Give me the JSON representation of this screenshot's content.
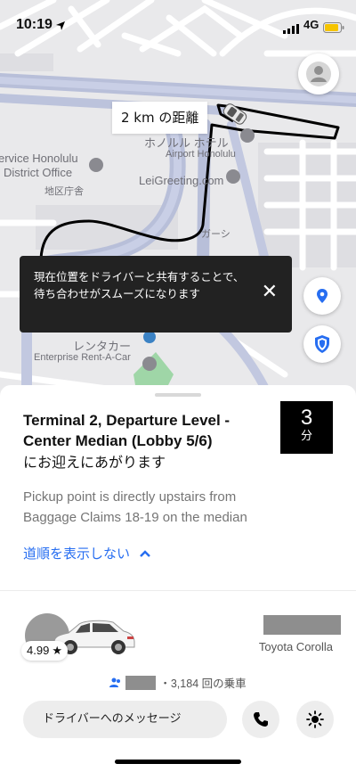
{
  "status_bar": {
    "time": "10:19",
    "network": "4G"
  },
  "map": {
    "distance_label": "2 km の距離",
    "labels": {
      "hotel": "ホノルル ホテル",
      "airport_honolulu": "Airport Honolulu",
      "service_line1": "ervice Honolulu",
      "service_line2": "District Office",
      "district_jp": "地区庁舎",
      "leigreeting": "LeiGreeting.com",
      "rental_jp": "レンタカー",
      "enterprise": "Enterprise Rent-A-Car",
      "garage_jp": "ガーシ"
    },
    "tooltip_text": "現在位置をドライバーと共有することで、待ち合わせがスムーズになります",
    "accent_color": "#276ef1"
  },
  "trip": {
    "pickup_title": "Terminal 2, Departure Level - Center Median (Lobby 5/6)",
    "pickup_subtitle": "にお迎えにあがります",
    "eta_value": "3",
    "eta_unit": "分",
    "pickup_note": "Pickup point is directly upstairs from Baggage Claims 18-19 on the median",
    "route_toggle_label": "道順を表示しない"
  },
  "driver": {
    "rating": "4.99",
    "car_model": "Toyota Corolla",
    "trips_text": "・3,184 回の乗車",
    "message_button_label": "ドライバーへのメッセージ"
  }
}
